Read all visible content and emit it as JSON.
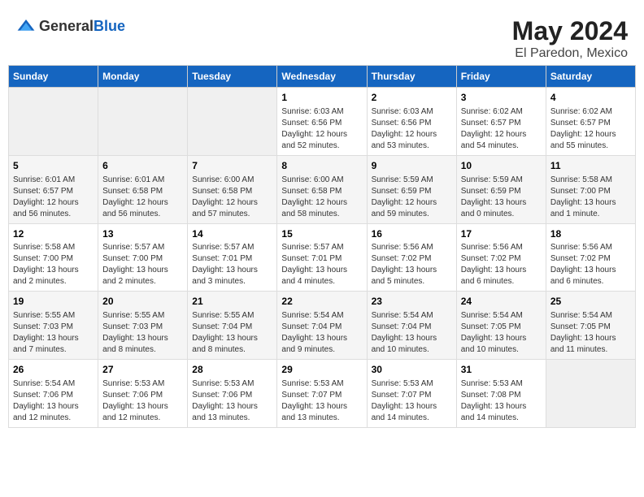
{
  "logo": {
    "text_general": "General",
    "text_blue": "Blue",
    "tagline": "GeneralBlue"
  },
  "title": "May 2024",
  "subtitle": "El Paredon, Mexico",
  "headers": [
    "Sunday",
    "Monday",
    "Tuesday",
    "Wednesday",
    "Thursday",
    "Friday",
    "Saturday"
  ],
  "weeks": [
    {
      "days": [
        {
          "num": "",
          "info": "",
          "empty": true
        },
        {
          "num": "",
          "info": "",
          "empty": true
        },
        {
          "num": "",
          "info": "",
          "empty": true
        },
        {
          "num": "1",
          "info": "Sunrise: 6:03 AM\nSunset: 6:56 PM\nDaylight: 12 hours and 52 minutes.",
          "empty": false
        },
        {
          "num": "2",
          "info": "Sunrise: 6:03 AM\nSunset: 6:56 PM\nDaylight: 12 hours and 53 minutes.",
          "empty": false
        },
        {
          "num": "3",
          "info": "Sunrise: 6:02 AM\nSunset: 6:57 PM\nDaylight: 12 hours and 54 minutes.",
          "empty": false
        },
        {
          "num": "4",
          "info": "Sunrise: 6:02 AM\nSunset: 6:57 PM\nDaylight: 12 hours and 55 minutes.",
          "empty": false
        }
      ]
    },
    {
      "days": [
        {
          "num": "5",
          "info": "Sunrise: 6:01 AM\nSunset: 6:57 PM\nDaylight: 12 hours and 56 minutes.",
          "empty": false
        },
        {
          "num": "6",
          "info": "Sunrise: 6:01 AM\nSunset: 6:58 PM\nDaylight: 12 hours and 56 minutes.",
          "empty": false
        },
        {
          "num": "7",
          "info": "Sunrise: 6:00 AM\nSunset: 6:58 PM\nDaylight: 12 hours and 57 minutes.",
          "empty": false
        },
        {
          "num": "8",
          "info": "Sunrise: 6:00 AM\nSunset: 6:58 PM\nDaylight: 12 hours and 58 minutes.",
          "empty": false
        },
        {
          "num": "9",
          "info": "Sunrise: 5:59 AM\nSunset: 6:59 PM\nDaylight: 12 hours and 59 minutes.",
          "empty": false
        },
        {
          "num": "10",
          "info": "Sunrise: 5:59 AM\nSunset: 6:59 PM\nDaylight: 13 hours and 0 minutes.",
          "empty": false
        },
        {
          "num": "11",
          "info": "Sunrise: 5:58 AM\nSunset: 7:00 PM\nDaylight: 13 hours and 1 minute.",
          "empty": false
        }
      ]
    },
    {
      "days": [
        {
          "num": "12",
          "info": "Sunrise: 5:58 AM\nSunset: 7:00 PM\nDaylight: 13 hours and 2 minutes.",
          "empty": false
        },
        {
          "num": "13",
          "info": "Sunrise: 5:57 AM\nSunset: 7:00 PM\nDaylight: 13 hours and 2 minutes.",
          "empty": false
        },
        {
          "num": "14",
          "info": "Sunrise: 5:57 AM\nSunset: 7:01 PM\nDaylight: 13 hours and 3 minutes.",
          "empty": false
        },
        {
          "num": "15",
          "info": "Sunrise: 5:57 AM\nSunset: 7:01 PM\nDaylight: 13 hours and 4 minutes.",
          "empty": false
        },
        {
          "num": "16",
          "info": "Sunrise: 5:56 AM\nSunset: 7:02 PM\nDaylight: 13 hours and 5 minutes.",
          "empty": false
        },
        {
          "num": "17",
          "info": "Sunrise: 5:56 AM\nSunset: 7:02 PM\nDaylight: 13 hours and 6 minutes.",
          "empty": false
        },
        {
          "num": "18",
          "info": "Sunrise: 5:56 AM\nSunset: 7:02 PM\nDaylight: 13 hours and 6 minutes.",
          "empty": false
        }
      ]
    },
    {
      "days": [
        {
          "num": "19",
          "info": "Sunrise: 5:55 AM\nSunset: 7:03 PM\nDaylight: 13 hours and 7 minutes.",
          "empty": false
        },
        {
          "num": "20",
          "info": "Sunrise: 5:55 AM\nSunset: 7:03 PM\nDaylight: 13 hours and 8 minutes.",
          "empty": false
        },
        {
          "num": "21",
          "info": "Sunrise: 5:55 AM\nSunset: 7:04 PM\nDaylight: 13 hours and 8 minutes.",
          "empty": false
        },
        {
          "num": "22",
          "info": "Sunrise: 5:54 AM\nSunset: 7:04 PM\nDaylight: 13 hours and 9 minutes.",
          "empty": false
        },
        {
          "num": "23",
          "info": "Sunrise: 5:54 AM\nSunset: 7:04 PM\nDaylight: 13 hours and 10 minutes.",
          "empty": false
        },
        {
          "num": "24",
          "info": "Sunrise: 5:54 AM\nSunset: 7:05 PM\nDaylight: 13 hours and 10 minutes.",
          "empty": false
        },
        {
          "num": "25",
          "info": "Sunrise: 5:54 AM\nSunset: 7:05 PM\nDaylight: 13 hours and 11 minutes.",
          "empty": false
        }
      ]
    },
    {
      "days": [
        {
          "num": "26",
          "info": "Sunrise: 5:54 AM\nSunset: 7:06 PM\nDaylight: 13 hours and 12 minutes.",
          "empty": false
        },
        {
          "num": "27",
          "info": "Sunrise: 5:53 AM\nSunset: 7:06 PM\nDaylight: 13 hours and 12 minutes.",
          "empty": false
        },
        {
          "num": "28",
          "info": "Sunrise: 5:53 AM\nSunset: 7:06 PM\nDaylight: 13 hours and 13 minutes.",
          "empty": false
        },
        {
          "num": "29",
          "info": "Sunrise: 5:53 AM\nSunset: 7:07 PM\nDaylight: 13 hours and 13 minutes.",
          "empty": false
        },
        {
          "num": "30",
          "info": "Sunrise: 5:53 AM\nSunset: 7:07 PM\nDaylight: 13 hours and 14 minutes.",
          "empty": false
        },
        {
          "num": "31",
          "info": "Sunrise: 5:53 AM\nSunset: 7:08 PM\nDaylight: 13 hours and 14 minutes.",
          "empty": false
        },
        {
          "num": "",
          "info": "",
          "empty": true
        }
      ]
    }
  ]
}
